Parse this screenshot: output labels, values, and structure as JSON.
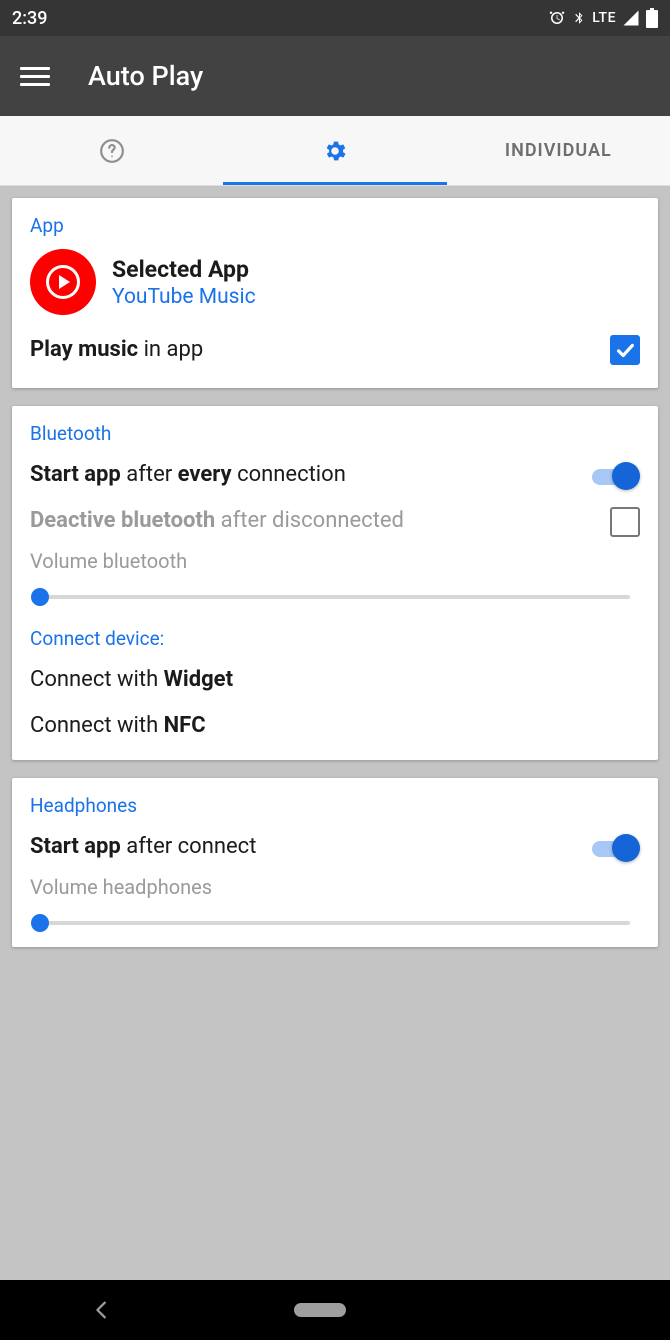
{
  "status": {
    "time": "2:39",
    "network": "LTE"
  },
  "header": {
    "title": "Auto Play"
  },
  "tabs": {
    "individual": "INDIVIDUAL"
  },
  "app_card": {
    "section": "App",
    "selected_title": "Selected App",
    "selected_sub": "YouTube Music",
    "play_bold": "Play music",
    "play_rest": " in app"
  },
  "bt_card": {
    "section": "Bluetooth",
    "start_b1": "Start app",
    "start_mid": " after ",
    "start_b2": "every",
    "start_rest": " connection",
    "deactivate_b": "Deactive bluetooth",
    "deactivate_rest": " after disconnected",
    "vol_label": "Volume bluetooth",
    "connect_section": "Connect device:",
    "connect_widget_pre": "Connect with ",
    "connect_widget_b": "Widget",
    "connect_nfc_pre": "Connect with ",
    "connect_nfc_b": "NFC"
  },
  "hp_card": {
    "section": "Headphones",
    "start_b": "Start app",
    "start_rest": " after connect",
    "vol_label": "Volume headphones"
  }
}
